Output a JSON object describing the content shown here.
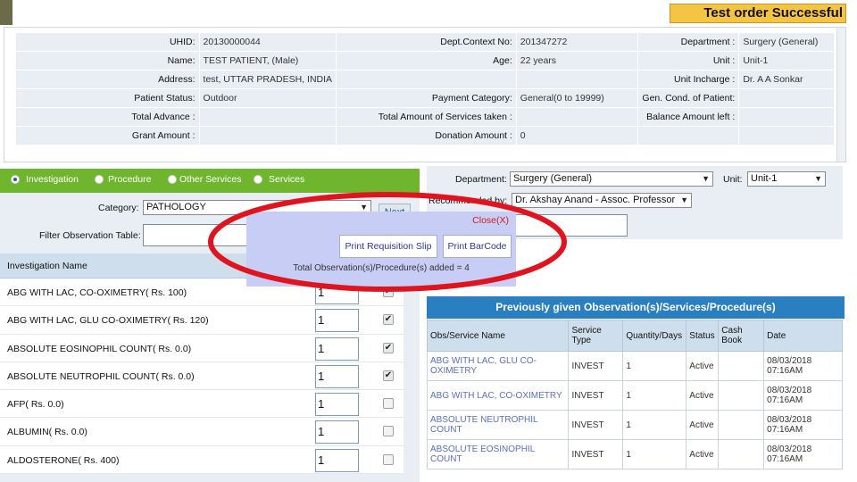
{
  "banner": "Test order Successful",
  "patient": {
    "rows": [
      [
        "UHID:",
        "20130000044",
        "Dept.Context No:",
        "201347272",
        "Department :",
        "Surgery (General)"
      ],
      [
        "Name:",
        "TEST PATIENT, (Male)",
        "Age:",
        "22 years",
        "Unit :",
        "Unit-1"
      ],
      [
        "Address:",
        "test, UTTAR PRADESH, INDIA",
        "",
        "",
        "Unit Incharge :",
        "Dr. A A Sonkar"
      ],
      [
        "Patient Status:",
        "Outdoor",
        "Payment Category:",
        "General(0 to 19999)",
        "Gen. Cond. of Patient:",
        ""
      ],
      [
        "Total Advance :",
        "",
        "Total Amount of Services taken :",
        "",
        "Balance Amount left :",
        ""
      ],
      [
        "Grant Amount :",
        "",
        "Donation Amount :",
        "0",
        "",
        ""
      ]
    ]
  },
  "tabs": {
    "investigation": "Investigation",
    "procedure": "Procedure",
    "other_services": "Other Services",
    "services": "Services"
  },
  "form": {
    "category_label": "Category:",
    "category_value": "PATHOLOGY",
    "next_label": "Next",
    "filter_label": "Filter Observation Table:",
    "department_label": "Department:",
    "department_value": "Surgery (General)",
    "unit_label": "Unit:",
    "unit_value": "Unit-1",
    "recommended_label": "Recommended by:",
    "recommended_value": "Dr. Akshay Anand - Assoc. Professor"
  },
  "investigations": {
    "header": "Investigation Name",
    "rows": [
      {
        "name": "ABG WITH LAC, CO-OXIMETRY( Rs. 100)",
        "qty": "1",
        "checked": true
      },
      {
        "name": "ABG WITH LAC, GLU CO-OXIMETRY( Rs. 120)",
        "qty": "1",
        "checked": true
      },
      {
        "name": "ABSOLUTE EOSINOPHIL COUNT( Rs. 0.0)",
        "qty": "1",
        "checked": true
      },
      {
        "name": "ABSOLUTE NEUTROPHIL COUNT( Rs. 0.0)",
        "qty": "1",
        "checked": true
      },
      {
        "name": "AFP( Rs. 0.0)",
        "qty": "1",
        "checked": false
      },
      {
        "name": "ALBUMIN( Rs. 0.0)",
        "qty": "1",
        "checked": false
      },
      {
        "name": "ALDOSTERONE( Rs. 400)",
        "qty": "1",
        "checked": false
      }
    ]
  },
  "popup": {
    "close": "Close(X)",
    "print_requisition": "Print Requisition Slip",
    "print_barcode": "Print BarCode",
    "total": "Total Observation(s)/Procedure(s) added = 4"
  },
  "previous": {
    "title": "Previously given Observation(s)/Services/Procedure(s)",
    "headers": [
      "Obs/Service Name",
      "Service Type",
      "Quantity/Days",
      "Status",
      "Cash Book",
      "Date"
    ],
    "rows": [
      [
        "ABG WITH LAC, GLU CO-OXIMETRY",
        "INVEST",
        "1",
        "Active",
        "",
        "08/03/2018 07:16AM"
      ],
      [
        "ABG WITH LAC, CO-OXIMETRY",
        "INVEST",
        "1",
        "Active",
        "",
        "08/03/2018 07:16AM"
      ],
      [
        "ABSOLUTE NEUTROPHIL COUNT",
        "INVEST",
        "1",
        "Active",
        "",
        "08/03/2018 07:16AM"
      ],
      [
        "ABSOLUTE EOSINOPHIL COUNT",
        "INVEST",
        "1",
        "Active",
        "",
        "08/03/2018 07:16AM"
      ]
    ]
  },
  "colors": {
    "accent_green": "#70b52e",
    "accent_blue": "#2a7fc0",
    "highlight_red": "#e0141e",
    "banner_yellow": "#f4c542"
  }
}
